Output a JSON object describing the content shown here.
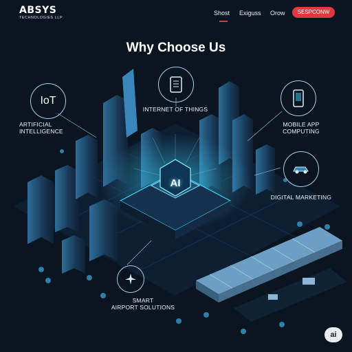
{
  "header": {
    "logo_main": "ABSYS",
    "logo_sub": "TECHNOLOGIES LLP",
    "nav": [
      "Shost",
      "Exiguss",
      "Orow"
    ],
    "cta_label": "SESPCONW",
    "accent_color": "#e0383e"
  },
  "main": {
    "title": "Why Choose Us",
    "center_chip_label": "AI",
    "features": [
      {
        "label": "ARTIFICIAL\nINTELLIGENCE",
        "icon": "iot-icon",
        "icon_text": "IoT"
      },
      {
        "label": "INTERNET OF THINGS",
        "icon": "document-device-icon"
      },
      {
        "label": "MOBILE APP\nCOMPUTING",
        "icon": "smartphone-icon"
      },
      {
        "label": "DIGITAL MARKETING",
        "icon": "car-icon"
      },
      {
        "label": "SMART\nAIRPORT SOLUTIONS",
        "icon": "airplane-icon"
      }
    ]
  },
  "footer": {
    "badge": "ai"
  }
}
